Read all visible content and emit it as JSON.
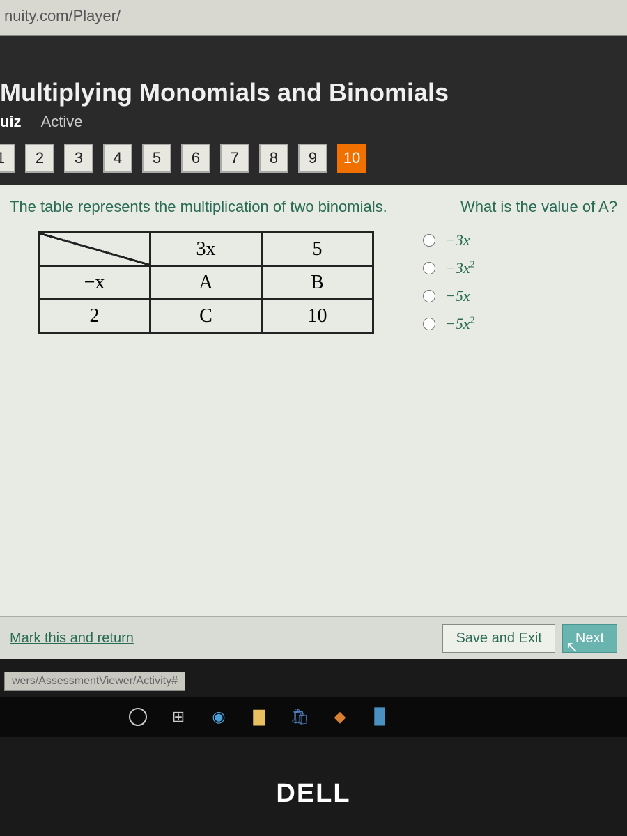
{
  "url_fragment": "nuity.com/Player/",
  "lesson_title": "Multiplying Monomials and Binomials",
  "subhead": {
    "quiz": "uiz",
    "active": "Active"
  },
  "qnav": {
    "items": [
      "1",
      "2",
      "3",
      "4",
      "5",
      "6",
      "7",
      "8",
      "9",
      "10"
    ],
    "current_index": 9
  },
  "prompt": {
    "left": "The table represents the multiplication of two binomials.",
    "right": "What is the value of A?"
  },
  "table": {
    "rows": [
      [
        "",
        "3x",
        "5"
      ],
      [
        "−x",
        "A",
        "B"
      ],
      [
        "2",
        "C",
        "10"
      ]
    ]
  },
  "choices": [
    {
      "display": "−3x",
      "sup": ""
    },
    {
      "display": "−3x",
      "sup": "2"
    },
    {
      "display": "−5x",
      "sup": ""
    },
    {
      "display": "−5x",
      "sup": "2"
    }
  ],
  "bottom": {
    "mark": "Mark this and return",
    "save": "Save and Exit",
    "next": "Next"
  },
  "status_path": "wers/AssessmentViewer/Activity#",
  "brand": "DELL"
}
